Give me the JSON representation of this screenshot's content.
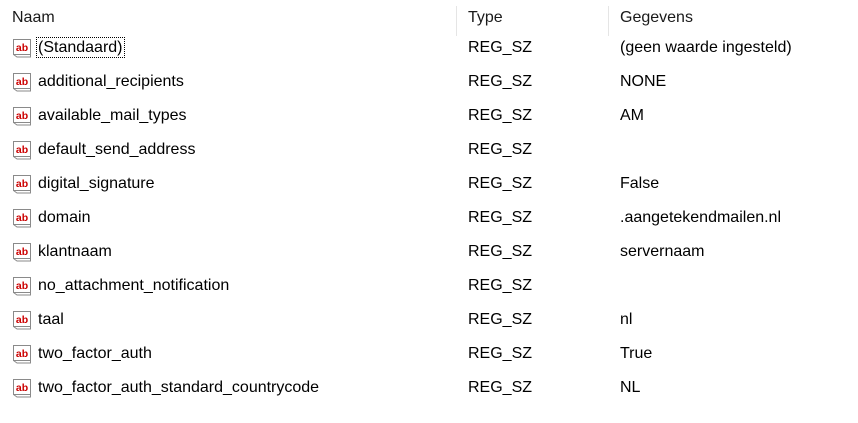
{
  "columns": {
    "name": "Naam",
    "type": "Type",
    "data": "Gegevens"
  },
  "rows": [
    {
      "name": "(Standaard)",
      "type": "REG_SZ",
      "data": "(geen waarde ingesteld)",
      "icon": "reg-string-icon"
    },
    {
      "name": "additional_recipients",
      "type": "REG_SZ",
      "data": "NONE",
      "icon": "reg-string-icon"
    },
    {
      "name": "available_mail_types",
      "type": "REG_SZ",
      "data": "AM",
      "icon": "reg-string-icon"
    },
    {
      "name": "default_send_address",
      "type": "REG_SZ",
      "data": "",
      "icon": "reg-string-icon"
    },
    {
      "name": "digital_signature",
      "type": "REG_SZ",
      "data": "False",
      "icon": "reg-string-icon"
    },
    {
      "name": "domain",
      "type": "REG_SZ",
      "data": ".aangetekendmailen.nl",
      "icon": "reg-string-icon"
    },
    {
      "name": "klantnaam",
      "type": "REG_SZ",
      "data": "servernaam",
      "icon": "reg-string-icon"
    },
    {
      "name": "no_attachment_notification",
      "type": "REG_SZ",
      "data": "",
      "icon": "reg-string-icon"
    },
    {
      "name": "taal",
      "type": "REG_SZ",
      "data": "nl",
      "icon": "reg-string-icon"
    },
    {
      "name": "two_factor_auth",
      "type": "REG_SZ",
      "data": "True",
      "icon": "reg-string-icon"
    },
    {
      "name": "two_factor_auth_standard_countrycode",
      "type": "REG_SZ",
      "data": "NL",
      "icon": "reg-string-icon"
    }
  ],
  "colors": {
    "icon_text": "#cc0000",
    "icon_bg": "#ffffff",
    "icon_border": "#8a8a8a"
  }
}
